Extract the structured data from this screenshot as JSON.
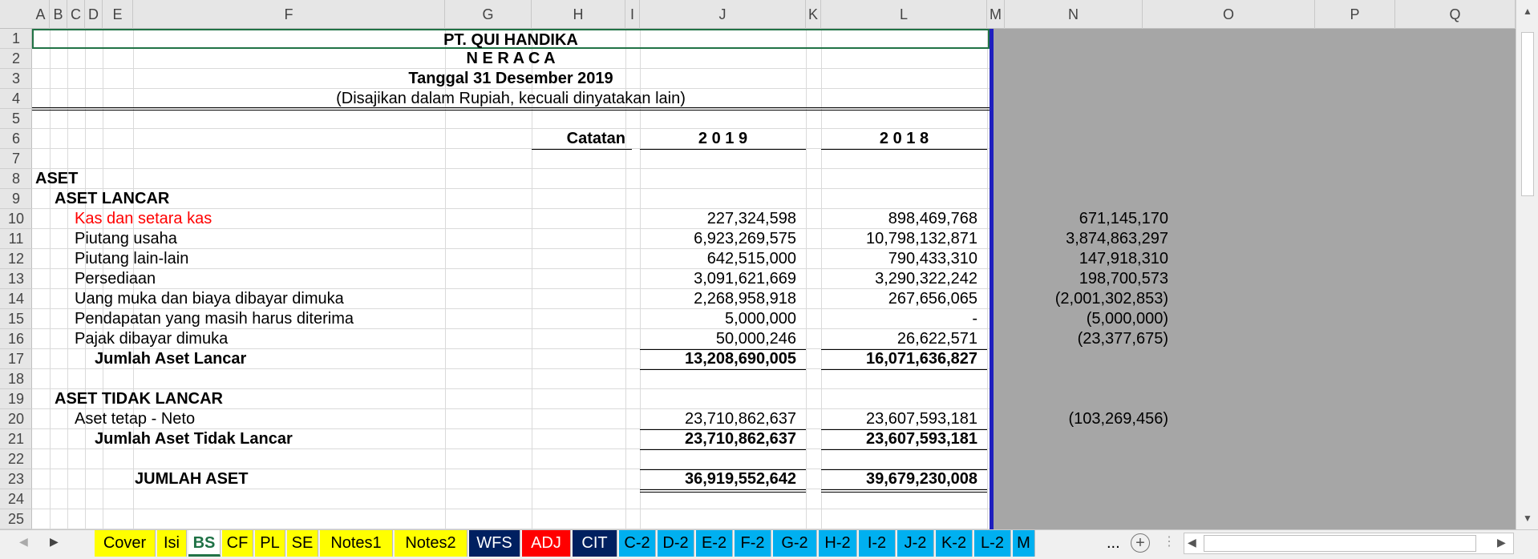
{
  "columns": [
    "A",
    "B",
    "C",
    "D",
    "E",
    "F",
    "G",
    "H",
    "I",
    "J",
    "K",
    "L",
    "M",
    "N",
    "O",
    "P",
    "Q"
  ],
  "rows": [
    "1",
    "2",
    "3",
    "4",
    "5",
    "6",
    "7",
    "8",
    "9",
    "10",
    "11",
    "12",
    "13",
    "14",
    "15",
    "16",
    "17",
    "18",
    "19",
    "20",
    "21",
    "22",
    "23",
    "24",
    "25"
  ],
  "header": {
    "company": "PT. QUI HANDIKA",
    "title": "N E R A C A",
    "date": "Tanggal 31 Desember 2019",
    "note": "(Disajikan dalam Rupiah, kecuali dinyatakan lain)"
  },
  "col_headers": {
    "catatan": "Catatan",
    "y2019": "2 0 1 9",
    "y2018": "2 0 1 8"
  },
  "sections": {
    "aset": "ASET",
    "aset_lancar": "ASET LANCAR",
    "aset_tidak_lancar": "ASET TIDAK LANCAR"
  },
  "current_assets": [
    {
      "label": "Kas dan setara kas",
      "y2019": "227,324,598",
      "y2018": "898,469,768",
      "diff": "671,145,170"
    },
    {
      "label": "Piutang usaha",
      "y2019": "6,923,269,575",
      "y2018": "10,798,132,871",
      "diff": "3,874,863,297"
    },
    {
      "label": "Piutang lain-lain",
      "y2019": "642,515,000",
      "y2018": "790,433,310",
      "diff": "147,918,310"
    },
    {
      "label": "Persediaan",
      "y2019": "3,091,621,669",
      "y2018": "3,290,322,242",
      "diff": "198,700,573"
    },
    {
      "label": "Uang muka dan biaya dibayar dimuka",
      "y2019": "2,268,958,918",
      "y2018": "267,656,065",
      "diff": "(2,001,302,853)"
    },
    {
      "label": "Pendapatan yang masih harus diterima",
      "y2019": "5,000,000",
      "y2018": "-",
      "diff": "(5,000,000)"
    },
    {
      "label": "Pajak dibayar dimuka",
      "y2019": "50,000,246",
      "y2018": "26,622,571",
      "diff": "(23,377,675)"
    }
  ],
  "total_current": {
    "label": "Jumlah Aset Lancar",
    "y2019": "13,208,690,005",
    "y2018": "16,071,636,827"
  },
  "noncurrent": {
    "label": "Aset tetap - Neto",
    "y2019": "23,710,862,637",
    "y2018": "23,607,593,181",
    "diff": "(103,269,456)"
  },
  "total_noncurrent": {
    "label": "Jumlah Aset Tidak Lancar",
    "y2019": "23,710,862,637",
    "y2018": "23,607,593,181"
  },
  "total_assets": {
    "label": "JUMLAH ASET",
    "y2019": "36,919,552,642",
    "y2018": "39,679,230,008"
  },
  "tabs": [
    {
      "label": "Cover",
      "bg": "#ffff00",
      "fg": "#000000"
    },
    {
      "label": "Isi",
      "bg": "#ffff00",
      "fg": "#000000"
    },
    {
      "label": "BS",
      "bg": "#ffffff",
      "fg": "#1e7145",
      "active": true
    },
    {
      "label": "CF",
      "bg": "#ffff00",
      "fg": "#000000"
    },
    {
      "label": "PL",
      "bg": "#ffff00",
      "fg": "#000000"
    },
    {
      "label": "SE",
      "bg": "#ffff00",
      "fg": "#000000"
    },
    {
      "label": "Notes1",
      "bg": "#ffff00",
      "fg": "#000000"
    },
    {
      "label": "Notes2",
      "bg": "#ffff00",
      "fg": "#000000"
    },
    {
      "label": "WFS",
      "bg": "#002060",
      "fg": "#ffffff"
    },
    {
      "label": "ADJ",
      "bg": "#ff0000",
      "fg": "#ffffff"
    },
    {
      "label": "CIT",
      "bg": "#002060",
      "fg": "#ffffff"
    },
    {
      "label": "C-2",
      "bg": "#00b0f0",
      "fg": "#000000"
    },
    {
      "label": "D-2",
      "bg": "#00b0f0",
      "fg": "#000000"
    },
    {
      "label": "E-2",
      "bg": "#00b0f0",
      "fg": "#000000"
    },
    {
      "label": "F-2",
      "bg": "#00b0f0",
      "fg": "#000000"
    },
    {
      "label": "G-2",
      "bg": "#00b0f0",
      "fg": "#000000"
    },
    {
      "label": "H-2",
      "bg": "#00b0f0",
      "fg": "#000000"
    },
    {
      "label": "I-2",
      "bg": "#00b0f0",
      "fg": "#000000"
    },
    {
      "label": "J-2",
      "bg": "#00b0f0",
      "fg": "#000000"
    },
    {
      "label": "K-2",
      "bg": "#00b0f0",
      "fg": "#000000"
    },
    {
      "label": "L-2",
      "bg": "#00b0f0",
      "fg": "#000000"
    },
    {
      "label": "M",
      "bg": "#00b0f0",
      "fg": "#000000"
    }
  ],
  "tab_more": "...",
  "icons": {
    "next_sheet": "triangle-right",
    "add_sheet": "circle-plus",
    "scroll_left": "triangle-left",
    "scroll_right": "triangle-right",
    "scroll_up": "triangle-up",
    "scroll_down": "triangle-down"
  }
}
